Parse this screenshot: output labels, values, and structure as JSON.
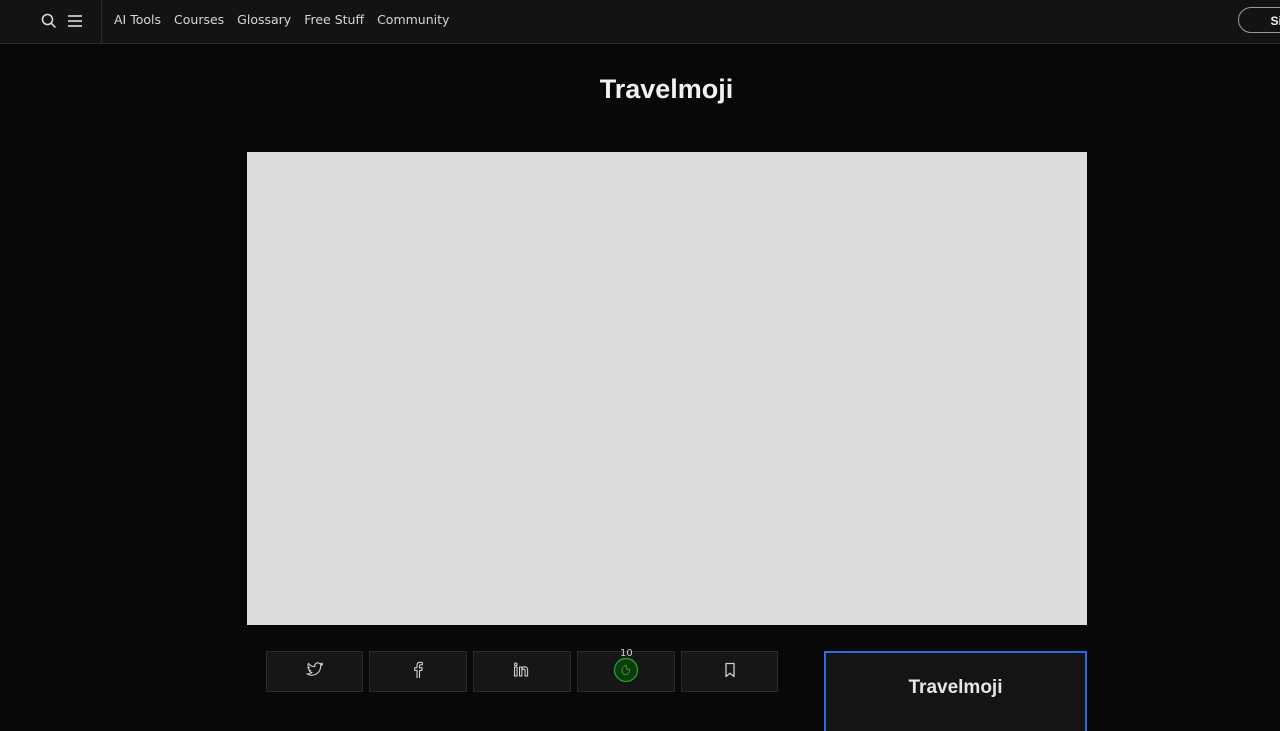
{
  "header": {
    "icons": [
      "search-icon",
      "menu-icon"
    ],
    "nav_items": [
      "AI Tools",
      "Courses",
      "Glossary",
      "Free Stuff",
      "Community"
    ],
    "signin_label": "Sign"
  },
  "page": {
    "title": "Travelmoji"
  },
  "share_bar": {
    "buttons": [
      "twitter-icon",
      "facebook-icon",
      "linkedin-icon",
      "upvote-icon",
      "bookmark-icon"
    ],
    "upvote_count": "10",
    "upvote_color": "#1f7a1f"
  },
  "sidebar_card": {
    "title": "Travelmoji",
    "accent": "#2d6ae3"
  },
  "colors": {
    "background": "#080808",
    "topbar": "#131313",
    "hero_placeholder": "#dcdcdc"
  }
}
